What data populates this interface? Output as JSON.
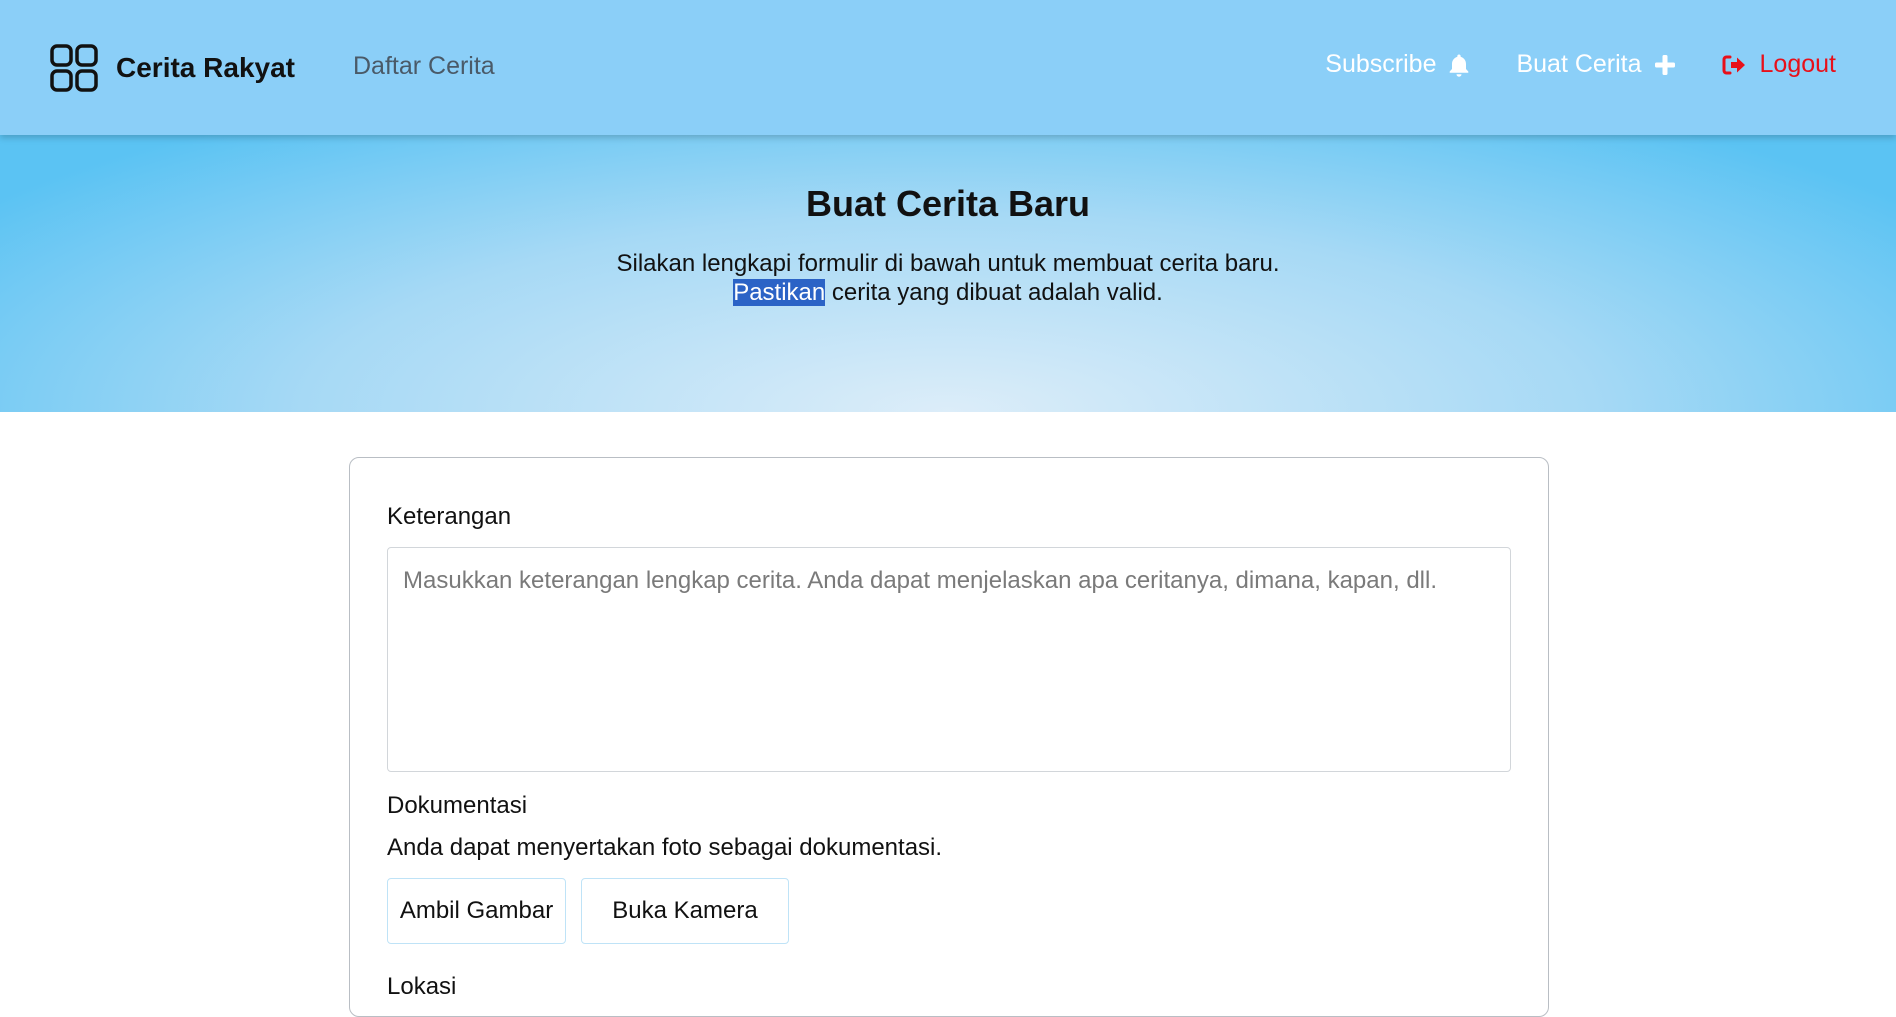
{
  "header": {
    "brand_name": "Cerita Rakyat",
    "brand_icon": "grid-icon",
    "nav_link": "Daftar Cerita",
    "subscribe_label": "Subscribe",
    "subscribe_icon": "bell-icon",
    "create_label": "Buat Cerita",
    "create_icon": "plus-icon",
    "logout_label": "Logout",
    "logout_icon": "logout-icon",
    "colors": {
      "bg": "#8bcff8",
      "logout": "#e8101a"
    }
  },
  "hero": {
    "title": "Buat Cerita Baru",
    "line1": "Silakan lengkapi formulir di bawah untuk membuat cerita baru.",
    "line2_highlighted": "Pastikan",
    "line2_rest": " cerita yang dibuat adalah valid."
  },
  "form": {
    "description_label": "Keterangan",
    "description_value": "",
    "description_placeholder": "Masukkan keterangan lengkap cerita. Anda dapat menjelaskan apa ceritanya, dimana, kapan, dll.",
    "documentation_label": "Dokumentasi",
    "documentation_desc": "Anda dapat menyertakan foto sebagai dokumentasi.",
    "take_photo_button": "Ambil Gambar",
    "open_camera_button": "Buka Kamera",
    "location_label": "Lokasi"
  }
}
